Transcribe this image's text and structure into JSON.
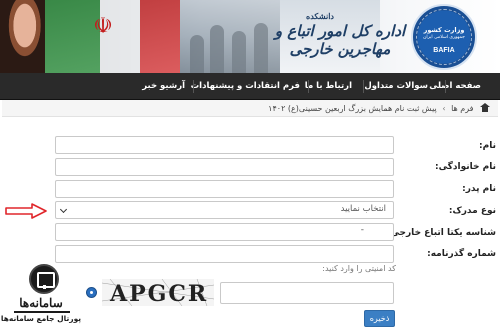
{
  "banner": {
    "title_pre": "دانشکده",
    "title_main": "اداره کل امور اتباع و مهاجرین خارجی",
    "logo": {
      "line1": "وزارت کشور",
      "line2": "جمهوری اسلامی ایران",
      "line3": "BAFIA"
    }
  },
  "nav": {
    "items": [
      {
        "label": "صفحه اصلی"
      },
      {
        "label": "سوالات متداول"
      },
      {
        "label": "ارتباط با ما"
      },
      {
        "label": "فرم انتقادات و پیشنهادات"
      },
      {
        "label": "آرشیو خبر"
      }
    ]
  },
  "breadcrumb": {
    "root": "فرم ها",
    "current": "پیش ثبت نام همایش بزرگ اربعین حسینی(ع) ۱۴۰۲"
  },
  "form": {
    "name_label": "نام:",
    "family_label": "نام خانوادگی:",
    "father_label": "نام پدر:",
    "doc_type_label": "نوع مدرک:",
    "doc_type_selected": "انتخاب نمایید",
    "foreign_id_label": "شناسه یکتا اتباع خارجی:",
    "foreign_id_value": "-",
    "passport_label": "شماره گذرنامه:",
    "captcha_prompt": "کد امنیتی را وارد کنید:",
    "captcha_text": "APGCR",
    "submit_label": "ذخیره"
  },
  "watermark": {
    "title": "سامانه‌ها",
    "subtitle": "پورتال جامع سامانه‌ها"
  },
  "colors": {
    "navbar": "#2a2a2a",
    "accent_button": "#3b7fc4",
    "arrow": "#e0262b",
    "logo": "#1d5fb0"
  }
}
